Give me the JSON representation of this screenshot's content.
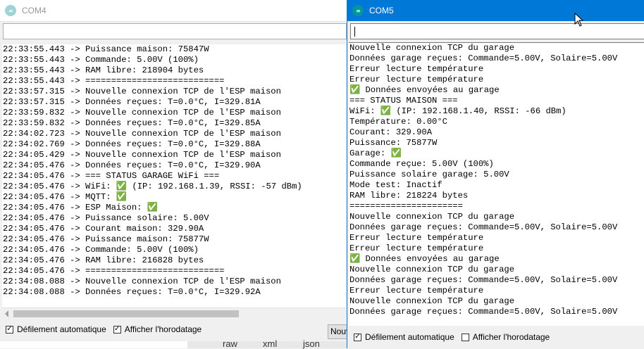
{
  "com4": {
    "title": "COM4",
    "logo": "∞",
    "lines": [
      "22:33:55.443 -> Puissance maison: 75847W",
      "22:33:55.443 -> Commande: 5.00V (100%)",
      "22:33:55.443 -> RAM libre: 218904 bytes",
      "22:33:55.443 -> ===========================",
      "22:33:57.315 -> Nouvelle connexion TCP de l'ESP maison",
      "22:33:57.315 -> Données reçues: T=0.0°C, I=329.81A",
      "22:33:59.832 -> Nouvelle connexion TCP de l'ESP maison",
      "22:33:59.832 -> Données reçues: T=0.0°C, I=329.85A",
      "22:34:02.723 -> Nouvelle connexion TCP de l'ESP maison",
      "22:34:02.769 -> Données reçues: T=0.0°C, I=329.88A",
      "22:34:05.429 -> Nouvelle connexion TCP de l'ESP maison",
      "22:34:05.476 -> Données reçues: T=0.0°C, I=329.90A",
      "22:34:05.476 -> === STATUS GARAGE WiFi ===",
      "22:34:05.476 -> WiFi: ✅ (IP: 192.168.1.39, RSSI: -57 dBm)",
      "22:34:05.476 -> MQTT: ✅",
      "22:34:05.476 -> ESP Maison: ✅",
      "22:34:05.476 -> Puissance solaire: 5.00V",
      "22:34:05.476 -> Courant maison: 329.90A",
      "22:34:05.476 -> Puissance maison: 75877W",
      "22:34:05.476 -> Commande: 5.00V (100%)",
      "22:34:05.476 -> RAM libre: 216828 bytes",
      "22:34:05.476 -> ===========================",
      "22:34:08.088 -> Nouvelle connexion TCP de l'ESP maison",
      "22:34:08.088 -> Données reçues: T=0.0°C, I=329.92A"
    ],
    "autoscroll_label": "Défilement automatique",
    "timestamp_label": "Afficher l'horodatage",
    "autoscroll_check": "✓",
    "timestamp_check": "✓",
    "new_button": "Nouvelle ligne"
  },
  "com5": {
    "title": "COM5",
    "logo": "∞",
    "lines": [
      "Nouvelle connexion TCP du garage",
      "Données garage reçues: Commande=5.00V, Solaire=5.00V",
      "Erreur lecture température",
      "Erreur lecture température",
      "✅ Données envoyées au garage",
      "=== STATUS MAISON ===",
      "WiFi: ✅ (IP: 192.168.1.40, RSSI: -66 dBm)",
      "Température: 0.00°C",
      "Courant: 329.90A",
      "Puissance: 75877W",
      "Garage: ✅",
      "Commande reçue: 5.00V (100%)",
      "Puissance solaire garage: 5.00V",
      "Mode test: Inactif",
      "RAM libre: 218224 bytes",
      "======================",
      "Nouvelle connexion TCP du garage",
      "Données garage reçues: Commande=5.00V, Solaire=5.00V",
      "Erreur lecture température",
      "Erreur lecture température",
      "✅ Données envoyées au garage",
      "Nouvelle connexion TCP du garage",
      "Données garage reçues: Commande=5.00V, Solaire=5.00V",
      "Erreur lecture température",
      "Nouvelle connexion TCP du garage",
      "Données garage reçues: Commande=5.00V, Solaire=5.00V"
    ],
    "autoscroll_label": "Défilement automatique",
    "timestamp_label": "Afficher l'horodatage",
    "autoscroll_check": "✓",
    "timestamp_check": ""
  },
  "background_strip": {
    "items": [
      "raw",
      "xml",
      "json"
    ]
  },
  "colors": {
    "active_titlebar": "#0078d7",
    "arduino_teal": "#00979c"
  }
}
